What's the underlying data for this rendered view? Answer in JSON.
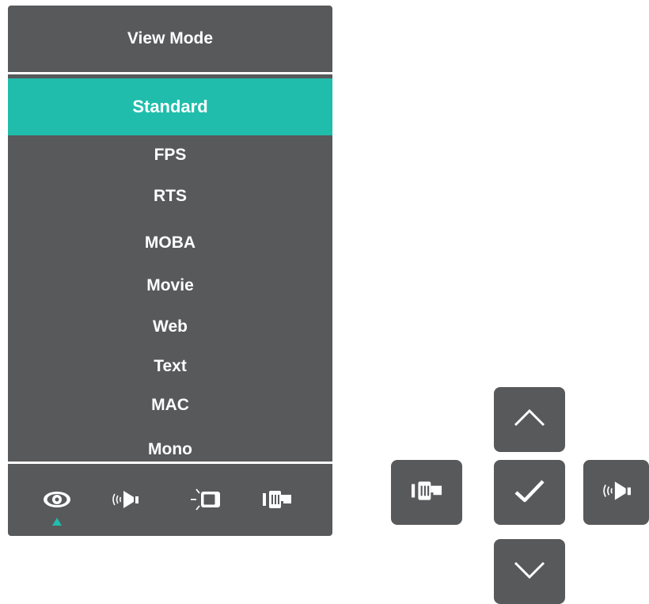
{
  "osd_menu": {
    "title": "View Mode",
    "items": [
      {
        "label": "Standard",
        "selected": true
      },
      {
        "label": "FPS",
        "selected": false
      },
      {
        "label": "RTS",
        "selected": false
      },
      {
        "label": "MOBA",
        "selected": false
      },
      {
        "label": "Movie",
        "selected": false
      },
      {
        "label": "Web",
        "selected": false
      },
      {
        "label": "Text",
        "selected": false
      },
      {
        "label": "MAC",
        "selected": false
      },
      {
        "label": "Mono",
        "selected": false
      }
    ],
    "selected_color": "#20bdac",
    "panel_color": "#58595b",
    "bottom_icons": [
      "view-mode-eye-icon",
      "audio-speaker-icon",
      "brightness-display-icon",
      "input-source-icon"
    ],
    "active_bottom_icon": "view-mode-eye-icon"
  },
  "control_keys": {
    "up": "chevron-up-icon",
    "left": "input-source-icon",
    "center": "checkmark-icon",
    "right": "audio-speaker-icon",
    "down": "chevron-down-icon"
  }
}
